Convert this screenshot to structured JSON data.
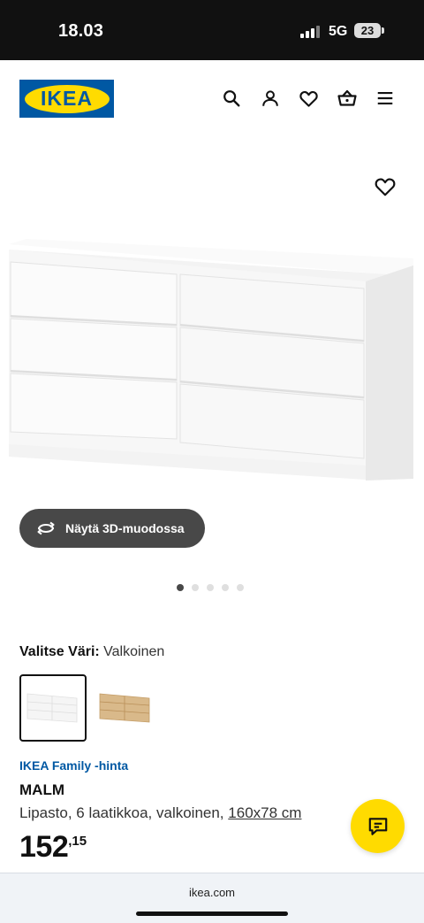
{
  "status_bar": {
    "time": "18.03",
    "network": "5G",
    "battery": "23"
  },
  "header": {
    "logo_text": "IKEA",
    "icons": [
      "search-icon",
      "user-icon",
      "heart-icon",
      "basket-icon",
      "menu-icon"
    ]
  },
  "gallery": {
    "view_3d_label": "Näytä 3D-muodossa",
    "dot_count": 5,
    "active_dot": 1
  },
  "color_selector": {
    "label": "Valitse Väri:",
    "value": "Valkoinen",
    "options": [
      "white",
      "oak"
    ]
  },
  "product": {
    "family_price_label": "IKEA Family -hinta",
    "name": "MALM",
    "description": "Lipasto, 6 laatikkoa, valkoinen,",
    "dimensions": "160x78 cm",
    "price_integer": "152",
    "price_decimals": ",15"
  },
  "browser": {
    "url": "ikea.com"
  },
  "colors": {
    "ikea_blue": "#0058a3",
    "ikea_yellow": "#ffdb00",
    "dark_button": "#484848"
  }
}
